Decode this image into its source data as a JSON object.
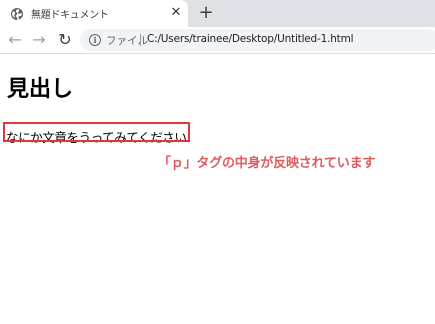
{
  "tab": {
    "title": "無題ドキュメント",
    "icon": "globe-icon",
    "close_glyph": "✕"
  },
  "new_tab_glyph": "+",
  "toolbar": {
    "back_glyph": "←",
    "forward_glyph": "→",
    "reload_glyph": "↻",
    "info_glyph": "i",
    "scheme_label": "ファイル",
    "url": "C:/Users/trainee/Desktop/Untitled-1.html"
  },
  "page": {
    "heading": "見出し",
    "paragraph": "なにか文章をうってみてください"
  },
  "annotation": {
    "text": "「ｐ」タグの中身が反映されています",
    "color": "#e05a5e",
    "box_color": "#e0373c"
  }
}
